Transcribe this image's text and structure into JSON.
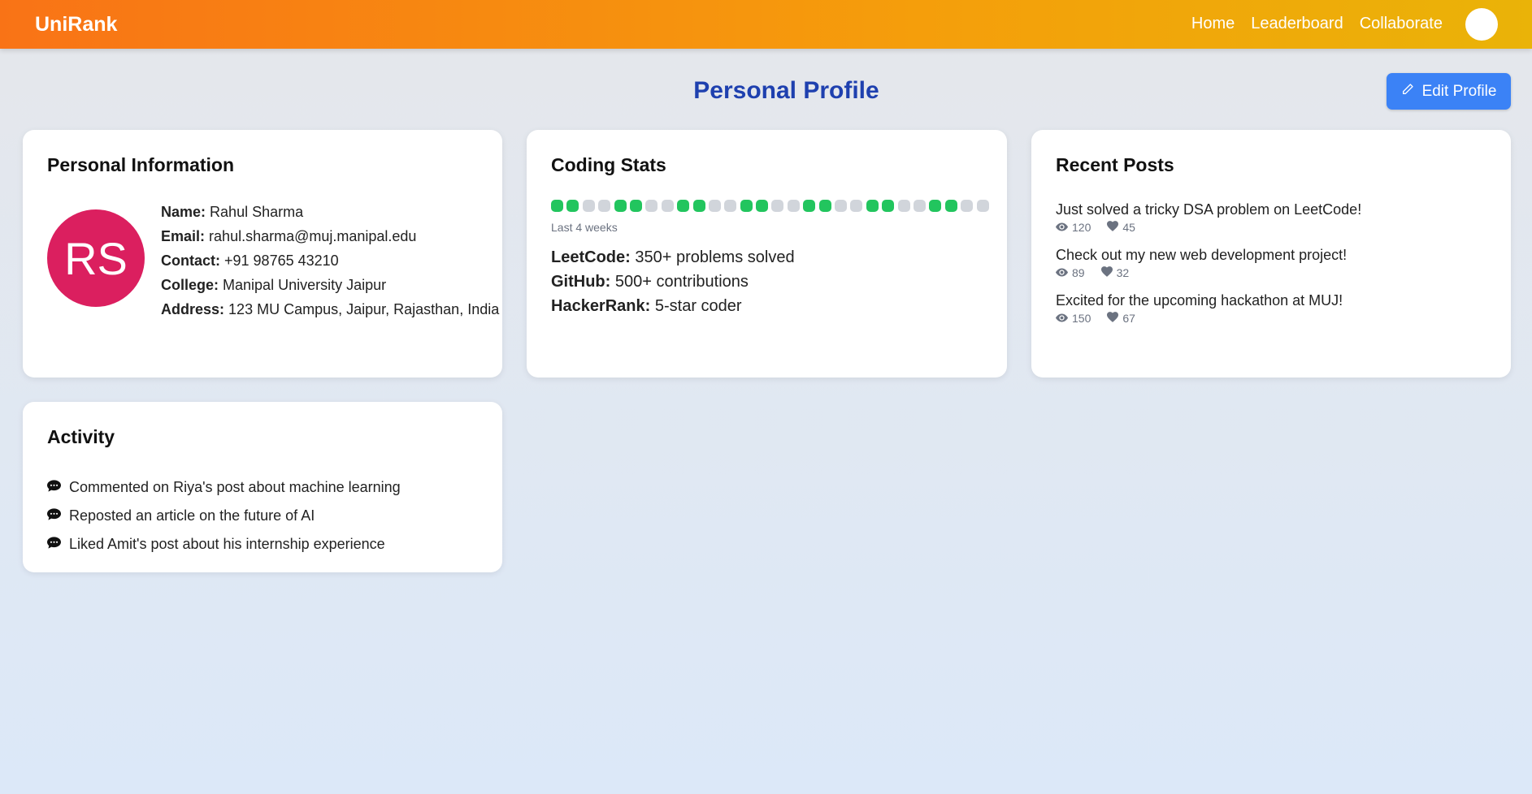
{
  "nav": {
    "brand": "UniRank",
    "links": [
      "Home",
      "Leaderboard",
      "Collaborate"
    ]
  },
  "page": {
    "title": "Personal Profile",
    "edit_label": "Edit Profile"
  },
  "personal": {
    "heading": "Personal Information",
    "initials": "RS",
    "avatar_color": "#db1f5f",
    "fields": [
      {
        "label": "Name:",
        "value": "Rahul Sharma"
      },
      {
        "label": "Email:",
        "value": "rahul.sharma@muj.manipal.edu"
      },
      {
        "label": "Contact:",
        "value": "+91 98765 43210"
      },
      {
        "label": "College:",
        "value": "Manipal University Jaipur"
      },
      {
        "label": "Address:",
        "value": "123 MU Campus, Jaipur, Rajasthan, India"
      }
    ]
  },
  "stats": {
    "heading": "Coding Stats",
    "activity_grid": [
      1,
      1,
      0,
      0,
      1,
      1,
      0,
      0,
      1,
      1,
      0,
      0,
      1,
      1,
      0,
      0,
      1,
      1,
      0,
      0,
      1,
      1,
      0,
      0,
      1,
      1,
      0,
      0
    ],
    "active_color": "#22c55e",
    "inactive_color": "#d1d5db",
    "caption": "Last 4 weeks",
    "items": [
      {
        "label": "LeetCode:",
        "value": "350+ problems solved"
      },
      {
        "label": "GitHub:",
        "value": "500+ contributions"
      },
      {
        "label": "HackerRank:",
        "value": "5-star coder"
      }
    ]
  },
  "posts": {
    "heading": "Recent Posts",
    "items": [
      {
        "title": "Just solved a tricky DSA problem on LeetCode!",
        "views": "120",
        "likes": "45"
      },
      {
        "title": "Check out my new web development project!",
        "views": "89",
        "likes": "32"
      },
      {
        "title": "Excited for the upcoming hackathon at MUJ!",
        "views": "150",
        "likes": "67"
      }
    ]
  },
  "activity": {
    "heading": "Activity",
    "items": [
      "Commented on Riya's post about machine learning",
      "Reposted an article on the future of AI",
      "Liked Amit's post about his internship experience"
    ]
  }
}
